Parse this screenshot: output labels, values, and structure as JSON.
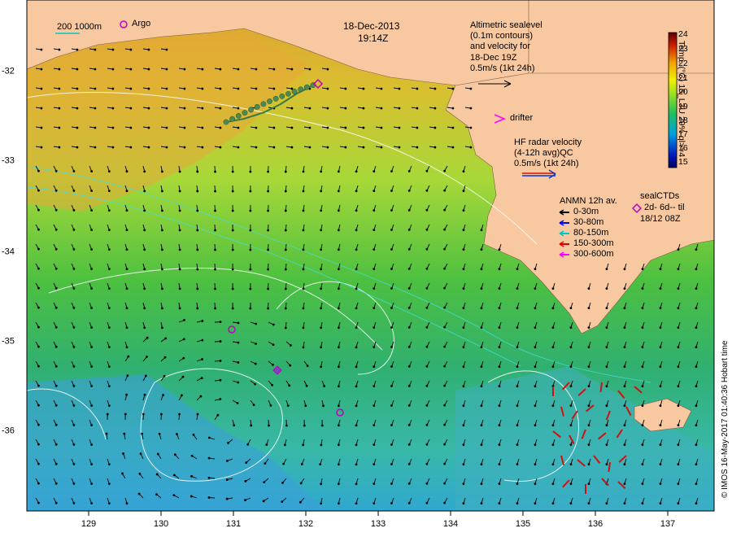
{
  "title": {
    "date": "18-Dec-2013",
    "time": "19:14Z"
  },
  "scale_bar": {
    "label": "200  1000m"
  },
  "argo_legend": {
    "label": "Argo"
  },
  "altimetry": {
    "lines": [
      "Altimetric sealevel",
      "(0.1m contours)",
      "and velocity for",
      "18-Dec 19Z",
      "0.5m/s (1kt 24h)"
    ]
  },
  "drifter": {
    "label": "drifter"
  },
  "hf_radar": {
    "lines": [
      "HF radar velocity",
      "(4-12h avg)QC",
      "0.5m/s (1kt 24h)"
    ]
  },
  "anmn": {
    "title": "ANMN 12h av.",
    "depths": [
      {
        "label": "0-30m",
        "color": "#000000"
      },
      {
        "label": "30-80m",
        "color": "#0000ff"
      },
      {
        "label": "80-150m",
        "color": "#00c8c8"
      },
      {
        "label": "150-300m",
        "color": "#e00000"
      },
      {
        "label": "300-600m",
        "color": "#ff00ff"
      }
    ]
  },
  "seal_ctds": {
    "lines": [
      "sealCTDs",
      "2d- 6d-- til",
      "18/12 08Z"
    ]
  },
  "colorbar": {
    "title": "Temp. (°C) 15_L3U 29% ql>=4",
    "ticks": [
      "24",
      "23",
      "22",
      "21",
      "20",
      "19",
      "18",
      "17",
      "16",
      "15"
    ]
  },
  "x_axis": {
    "ticks": [
      "129",
      "130",
      "131",
      "132",
      "133",
      "134",
      "135",
      "136",
      "137"
    ],
    "range": [
      128.2,
      137.7
    ]
  },
  "y_axis": {
    "ticks": [
      "-32",
      "-33",
      "-34",
      "-35",
      "-36"
    ],
    "range": [
      -36.9,
      -31.2
    ]
  },
  "credit": "© IMOS 16-May-2017 01:40:36 Hobart time",
  "colors": {
    "land": "#f8c8a0",
    "warm": "#e89a28",
    "mid": "#9acd32",
    "cool": "#2aa84a",
    "cold": "#19a0c8",
    "vector": "#000000",
    "hf_vector": "#d01010",
    "contour": "#ffffff",
    "argo": "#c000c0"
  }
}
